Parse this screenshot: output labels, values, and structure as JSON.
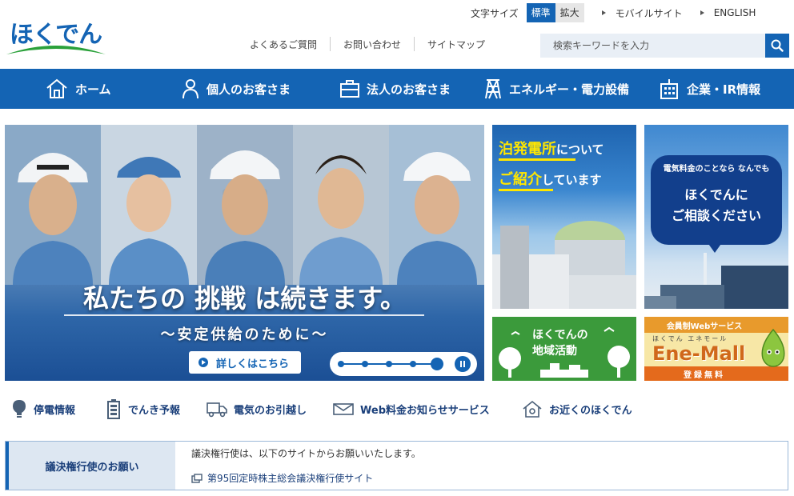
{
  "header": {
    "logo_text": "ほくでん",
    "font_size_label": "文字サイズ",
    "font_size_standard": "標準",
    "font_size_large": "拡大",
    "mobile_site": "モバイルサイト",
    "english": "ENGLISH",
    "faq": "よくあるご質問",
    "contact": "お問い合わせ",
    "sitemap": "サイトマップ",
    "search_placeholder": "検索キーワードを入力"
  },
  "nav": {
    "home": "ホーム",
    "personal": "個人のお客さま",
    "business": "法人のお客さま",
    "energy": "エネルギー・電力設備",
    "corporate": "企業・IR情報"
  },
  "hero": {
    "title": "私たちの 挑戦 は続きます。",
    "subtitle": "〜安定供給のために〜",
    "button": "詳しくはこちら",
    "slide_count": 5,
    "active_slide": 5
  },
  "banners": {
    "tomari": {
      "line1_strong": "泊発電所",
      "line1_rest": "について",
      "line2_strong": "ご紹介",
      "line2_rest": "しています"
    },
    "soudan": {
      "line1": "電気料金のことなら なんでも",
      "line2": "ほくでんに",
      "line3": "ご相談ください"
    },
    "chiiki": {
      "line1": "ほくでんの",
      "line2": "地域活動"
    },
    "enemall": {
      "top": "会員制Webサービス",
      "kana": "ほくでん エネモール",
      "logo": "Ene-Mall",
      "bottom": "登録無料"
    }
  },
  "quick_links": {
    "outage": "停電情報",
    "forecast": "でんき予報",
    "moving": "電気のお引越し",
    "web_bill": "Web料金お知らせサービス",
    "nearby": "お近くのほくでん"
  },
  "notice": {
    "heading": "議決権行使のお願い",
    "text": "議決権行使は、以下のサイトからお願いいたします。",
    "link": "第95回定時株主総会議決権行使サイト"
  }
}
